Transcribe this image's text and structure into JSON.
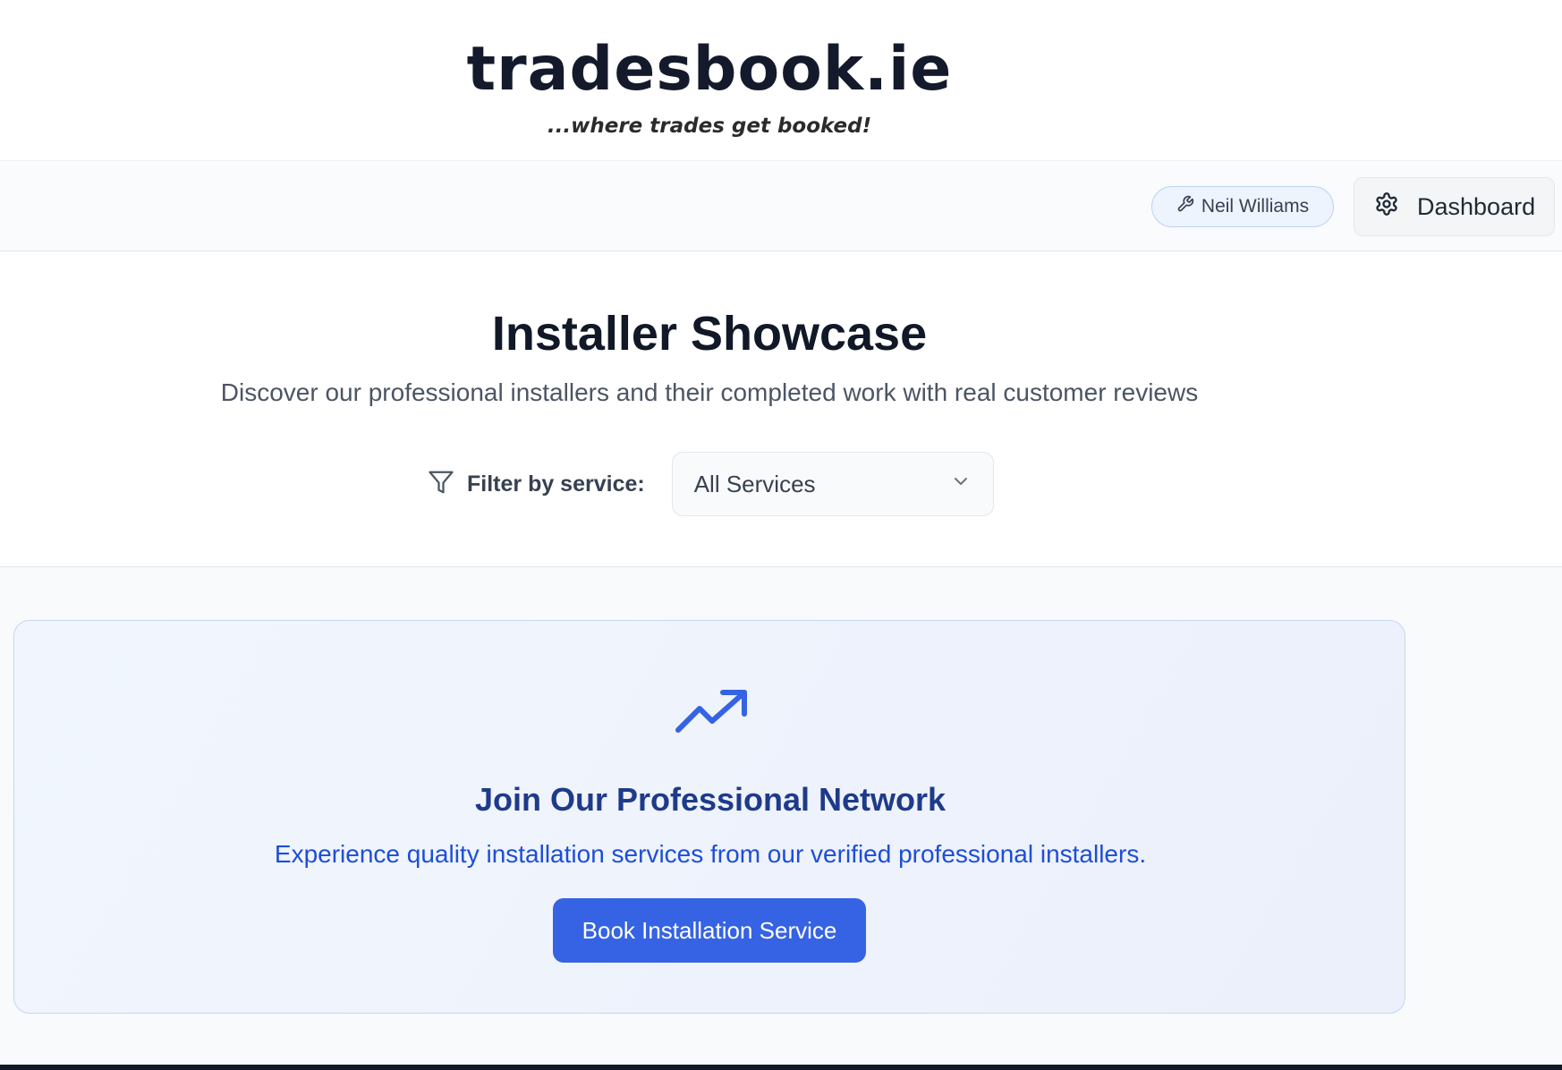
{
  "brand": {
    "logo_text": "tradesbook.ie",
    "tagline": "...where trades get booked!"
  },
  "nav": {
    "user_name": "Neil Williams",
    "user_icon": "wrench-icon",
    "dashboard_label": "Dashboard",
    "dashboard_icon": "gear-icon"
  },
  "hero": {
    "title": "Installer Showcase",
    "subtitle": "Discover our professional installers and their completed work with real customer reviews",
    "filter_label": "Filter by service:",
    "filter_icon": "filter-icon",
    "filter_selected": "All Services"
  },
  "cta": {
    "icon": "trending-up-icon",
    "title": "Join Our Professional Network",
    "text": "Experience quality installation services from our verified professional installers.",
    "button_label": "Book Installation Service"
  },
  "colors": {
    "accent": "#3563e3",
    "cta_title": "#1e3a8a",
    "cta_text": "#1d4ed8"
  }
}
